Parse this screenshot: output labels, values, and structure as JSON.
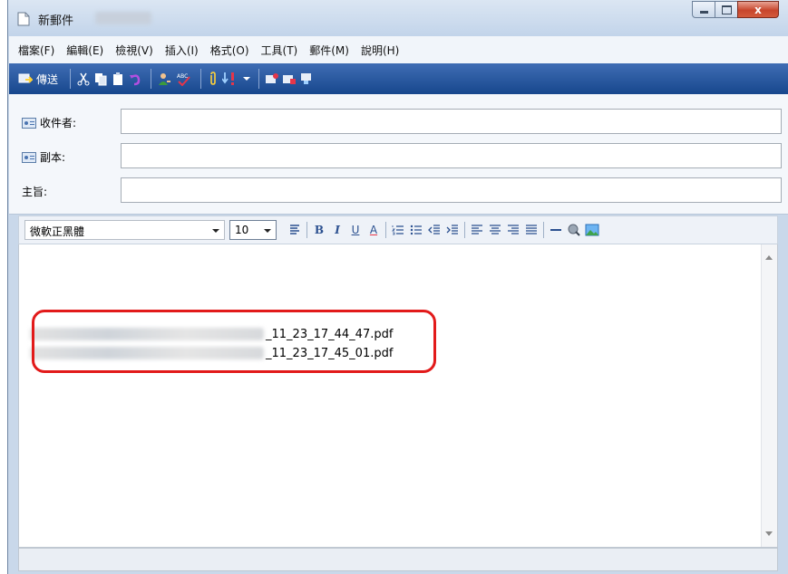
{
  "window": {
    "title": "新郵件",
    "controls": {
      "minimize": "",
      "maximize": "",
      "close": "x"
    }
  },
  "menu": [
    {
      "label": "檔案(F)"
    },
    {
      "label": "編輯(E)"
    },
    {
      "label": "檢視(V)"
    },
    {
      "label": "插入(I)"
    },
    {
      "label": "格式(O)"
    },
    {
      "label": "工具(T)"
    },
    {
      "label": "郵件(M)"
    },
    {
      "label": "說明(H)"
    }
  ],
  "toolbar": {
    "send_label": "傳送"
  },
  "header_fields": {
    "to_label": "收件者:",
    "to_value": "",
    "cc_label": "副本:",
    "cc_value": "",
    "subject_label": "主旨:",
    "subject_value": ""
  },
  "format": {
    "font": "微軟正黑體",
    "size": "10",
    "bold": "B",
    "italic": "I",
    "underline": "U",
    "font_color": "A"
  },
  "body": {
    "attachments": [
      {
        "name_suffix": "_11_23_17_44_47.pdf"
      },
      {
        "name_suffix": "_11_23_17_45_01.pdf"
      }
    ]
  },
  "colors": {
    "highlight": "#e21a1a",
    "toolbar": "#1f4f98"
  }
}
